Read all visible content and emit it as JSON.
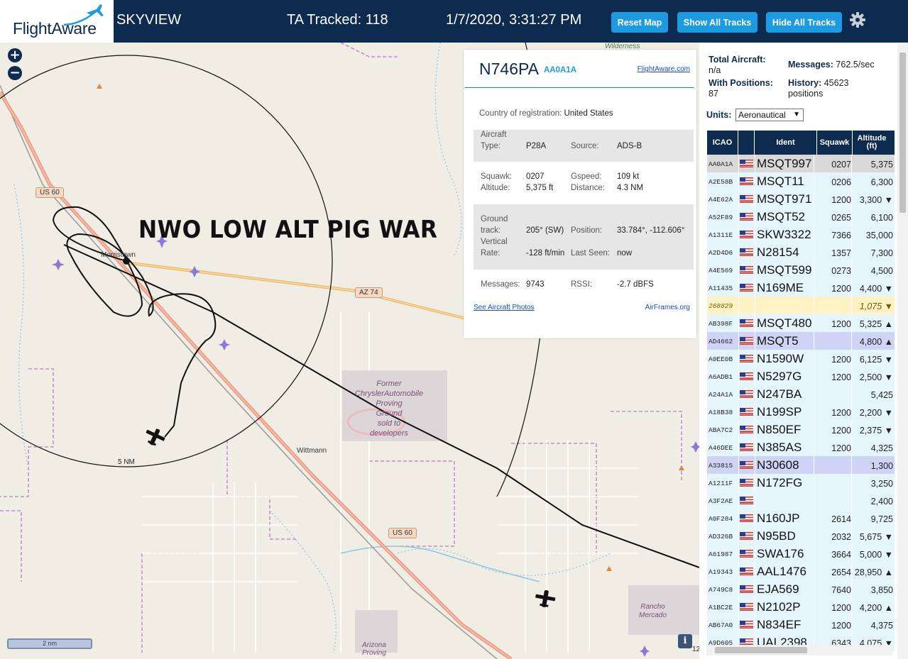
{
  "header": {
    "logo": "FlightAware",
    "app_name": "SKYVIEW",
    "ta_tracked": "TA Tracked: 118",
    "datetime": "1/7/2020, 3:31:27 PM",
    "buttons": {
      "reset_map": "Reset Map",
      "show_all": "Show All Tracks",
      "hide_all": "Hide All Tracks"
    },
    "colors": {
      "bar": "#0d2a4f",
      "button": "#1d9be1"
    }
  },
  "map": {
    "zoom_in": "+",
    "zoom_out": "−",
    "annotation": "NWO LOW ALT PIG WAR",
    "range_ring_label": "5 NM",
    "scale_label": "2 nm",
    "info_label": "i",
    "roads": [
      "US 60",
      "AZ 74",
      "US 60"
    ],
    "places": [
      "Morristown",
      "Wittmann",
      "Wilderness",
      "12"
    ],
    "areas": {
      "proving_ground": [
        "Former",
        "ChryslerAutomobile",
        "Proving",
        "Ground",
        "sold to",
        "developers"
      ],
      "rancho_mercado": [
        "Rancho",
        "Mercado"
      ],
      "arizona_proving": [
        "Arizona",
        "Proving"
      ]
    },
    "track_color": "#000000"
  },
  "popup": {
    "registration": "N746PA",
    "icao": "AA0A1A",
    "fa_link": "FlightAware.com",
    "country_label": "Country of registration:",
    "country": "United States",
    "aircraft_type_label_1": "Aircraft",
    "aircraft_type_label_2": "Type:",
    "aircraft_type": "P28A",
    "source_label": "Source:",
    "source": "ADS-B",
    "squawk_label": "Squawk:",
    "squawk": "0207",
    "gspeed_label": "Gspeed:",
    "gspeed": "109 kt",
    "altitude_label": "Altitude:",
    "altitude": "5,375 ft",
    "distance_label": "Distance:",
    "distance": "4.3 NM",
    "ground_track_label_1": "Ground",
    "ground_track_label_2": "track:",
    "ground_track": "205° (SW)",
    "position_label": "Position:",
    "position": "33.784°, -112.606°",
    "vrate_label_1": "Vertical",
    "vrate_label_2": "Rate:",
    "vrate": "-128 ft/min",
    "last_seen_label": "Last Seen:",
    "last_seen": "now",
    "messages_label": "Messages:",
    "messages": "9743",
    "rssi_label": "RSSI:",
    "rssi": "-2.7 dBFS",
    "photos_link": "See Aircraft Photos",
    "airframes_link": "AirFrames.org"
  },
  "sidebar": {
    "total_aircraft_label": "Total Aircraft:",
    "total_aircraft": "n/a",
    "with_positions_label": "With Positions:",
    "with_positions": "87",
    "messages_label": "Messages:",
    "messages": "762.5/sec",
    "history_label": "History:",
    "history": "45623",
    "history_unit": "positions",
    "units_label": "Units:",
    "units_value": "Aeronautical",
    "columns": [
      "ICAO",
      "Ident",
      "Squawk",
      "Altitude (ft)"
    ],
    "rows": [
      {
        "icao": "AA0A1A",
        "ident": "MSQT997",
        "squawk": "0207",
        "alt": "5,375",
        "selected": true
      },
      {
        "icao": "A2E58B",
        "ident": "MSQT11",
        "squawk": "0206",
        "alt": "6,300"
      },
      {
        "icao": "A4E62A",
        "ident": "MSQT971",
        "squawk": "1200",
        "alt": "3,300 ▼"
      },
      {
        "icao": "A52F89",
        "ident": "MSQT52",
        "squawk": "0265",
        "alt": "6,100"
      },
      {
        "icao": "A1311E",
        "ident": "SKW3322",
        "squawk": "7366",
        "alt": "35,000"
      },
      {
        "icao": "A2D4D6",
        "ident": "N28154",
        "squawk": "1357",
        "alt": "7,300"
      },
      {
        "icao": "A4E569",
        "ident": "MSQT599",
        "squawk": "0273",
        "alt": "4,500"
      },
      {
        "icao": "A11435",
        "ident": "N169ME",
        "squawk": "1200",
        "alt": "4,400 ▼"
      },
      {
        "icao": "268829",
        "ident": "",
        "squawk": "",
        "alt": "1,075 ▼",
        "yellow": true,
        "noflag": true
      },
      {
        "icao": "AB398F",
        "ident": "MSQT480",
        "squawk": "1200",
        "alt": "5,325 ▲"
      },
      {
        "icao": "AD4662",
        "ident": "MSQT5",
        "squawk": "",
        "alt": "4,800 ▲",
        "purple": true
      },
      {
        "icao": "A0EE0B",
        "ident": "N1590W",
        "squawk": "1200",
        "alt": "6,125 ▼"
      },
      {
        "icao": "A6ADB1",
        "ident": "N5297G",
        "squawk": "1200",
        "alt": "2,500 ▼"
      },
      {
        "icao": "A24A1A",
        "ident": "N247BA",
        "squawk": "",
        "alt": "5,425"
      },
      {
        "icao": "A18B38",
        "ident": "N199SP",
        "squawk": "1200",
        "alt": "2,200 ▼"
      },
      {
        "icao": "ABA7C2",
        "ident": "N850EF",
        "squawk": "1200",
        "alt": "2,375 ▼"
      },
      {
        "icao": "A46DEE",
        "ident": "N385AS",
        "squawk": "1200",
        "alt": "4,325"
      },
      {
        "icao": "A33815",
        "ident": "N30608",
        "squawk": "",
        "alt": "1,300",
        "purple": true
      },
      {
        "icao": "A1211F",
        "ident": "N172FG",
        "squawk": "",
        "alt": "3,250"
      },
      {
        "icao": "A3F2AE",
        "ident": "",
        "squawk": "",
        "alt": "2,400"
      },
      {
        "icao": "A0F284",
        "ident": "N160JP",
        "squawk": "2614",
        "alt": "9,725"
      },
      {
        "icao": "AD326B",
        "ident": "N95BD",
        "squawk": "2032",
        "alt": "5,675 ▼"
      },
      {
        "icao": "A61987",
        "ident": "SWA176",
        "squawk": "3664",
        "alt": "5,000 ▼"
      },
      {
        "icao": "A19343",
        "ident": "AAL1476",
        "squawk": "2654",
        "alt": "28,950 ▲"
      },
      {
        "icao": "A749C8",
        "ident": "EJA569",
        "squawk": "7640",
        "alt": "3,850"
      },
      {
        "icao": "A1BC2E",
        "ident": "N2102P",
        "squawk": "1200",
        "alt": "4,200 ▲"
      },
      {
        "icao": "AB67A0",
        "ident": "N834EF",
        "squawk": "1200",
        "alt": "4,375"
      },
      {
        "icao": "A9D605",
        "ident": "UAL2398",
        "squawk": "6343",
        "alt": "4,075 ▼"
      }
    ],
    "colors": {
      "row": "#e4f5fb",
      "selected": "#d9d9d9",
      "yellow": "#fff2c4",
      "purple": "#cfd3f5",
      "header": "#0d2a4f"
    }
  }
}
